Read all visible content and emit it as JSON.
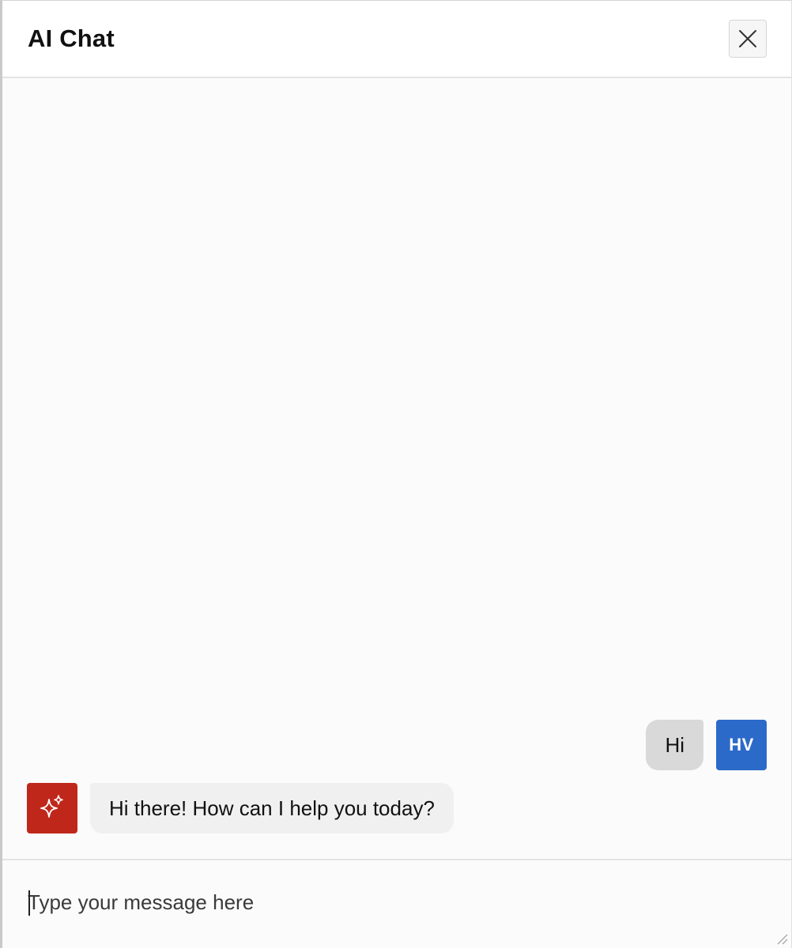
{
  "header": {
    "title": "AI Chat",
    "close_icon": "close-icon"
  },
  "messages": [
    {
      "role": "user",
      "text": "Hi",
      "avatar_initials": "HV",
      "avatar_color": "#2c6ac9"
    },
    {
      "role": "assistant",
      "text": "Hi there! How can I help you today?",
      "avatar_icon": "sparkle-icon",
      "avatar_color": "#c0271b"
    }
  ],
  "composer": {
    "placeholder": "Type your message here",
    "value": ""
  },
  "colors": {
    "user_avatar": "#2c6ac9",
    "assistant_avatar": "#c0271b",
    "user_bubble": "#d9d9d9",
    "assistant_bubble": "#f0f0f0"
  }
}
